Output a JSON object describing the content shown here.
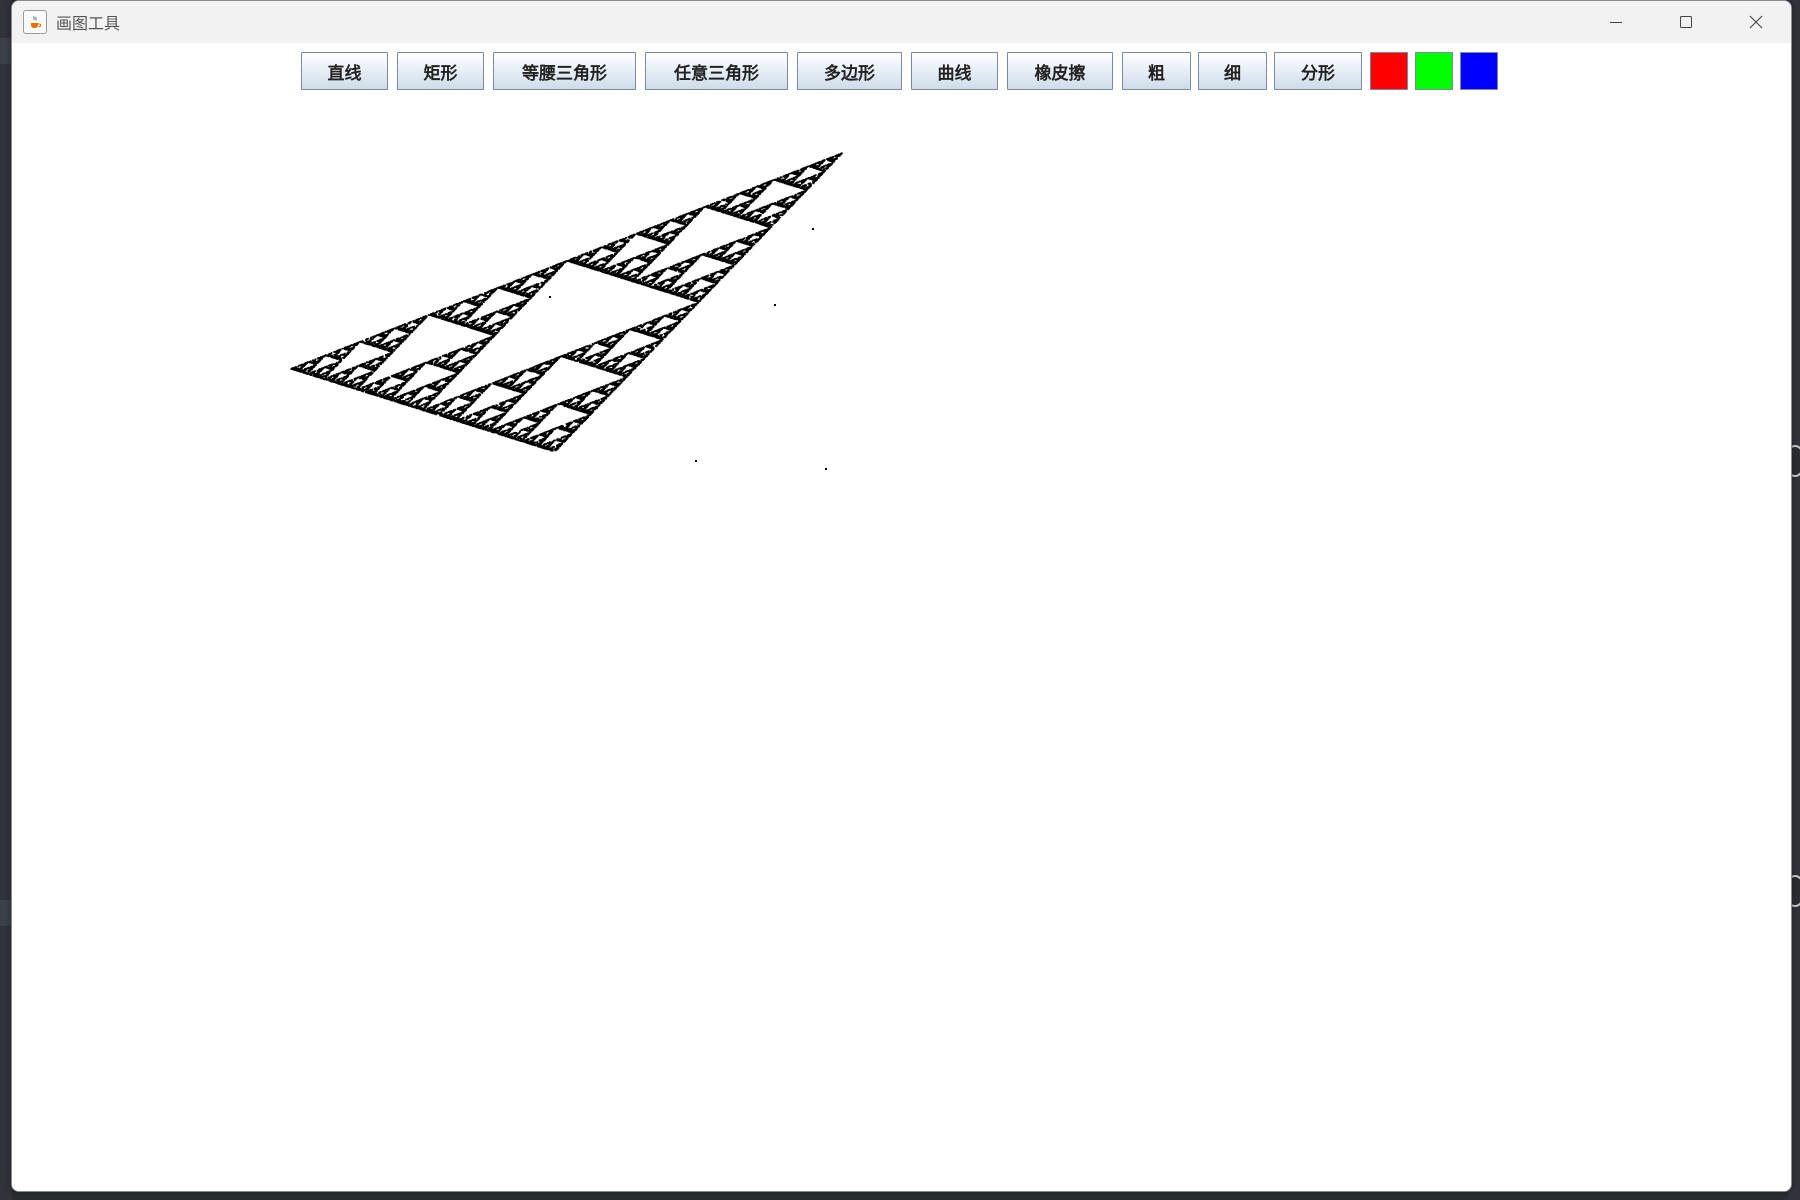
{
  "window": {
    "title": "画图工具"
  },
  "toolbar": {
    "buttons": [
      {
        "label": "直线"
      },
      {
        "label": "矩形"
      },
      {
        "label": "等腰三角形"
      },
      {
        "label": "任意三角形"
      },
      {
        "label": "多边形"
      },
      {
        "label": "曲线"
      },
      {
        "label": "橡皮擦"
      },
      {
        "label": "粗"
      },
      {
        "label": "细"
      },
      {
        "label": "分形"
      }
    ],
    "colors": [
      {
        "name": "red",
        "value": "#ff0000"
      },
      {
        "name": "green",
        "value": "#00ff00"
      },
      {
        "name": "blue",
        "value": "#0000ff"
      }
    ]
  },
  "canvas": {
    "drawing": "sierpinski-triangle-fractal",
    "stroke_color": "#000000"
  },
  "icons": {
    "app": "java-cup-icon",
    "minimize": "minimize-icon",
    "maximize": "maximize-icon",
    "close": "close-icon"
  }
}
